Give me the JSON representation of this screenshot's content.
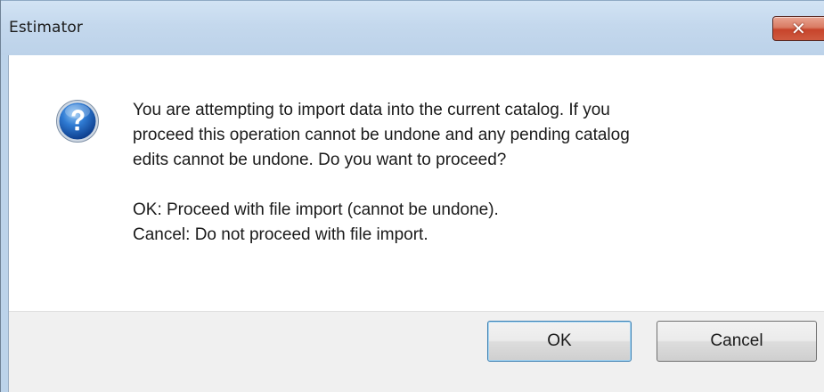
{
  "window": {
    "title": "Estimator",
    "close_icon": "close-icon"
  },
  "dialog": {
    "icon": "question-icon",
    "message_lines": [
      "You are attempting to import data into the current catalog.  If you",
      "proceed this operation cannot be undone and any pending catalog",
      "edits cannot be undone.  Do you want to proceed?"
    ],
    "option_lines": [
      "OK: Proceed with file import (cannot be undone).",
      "Cancel: Do not proceed with file import."
    ]
  },
  "buttons": {
    "ok_label": "OK",
    "cancel_label": "Cancel"
  },
  "colors": {
    "title_bar": "#c4d8ed",
    "close_button": "#c7442b",
    "footer": "#f0f0f0"
  }
}
